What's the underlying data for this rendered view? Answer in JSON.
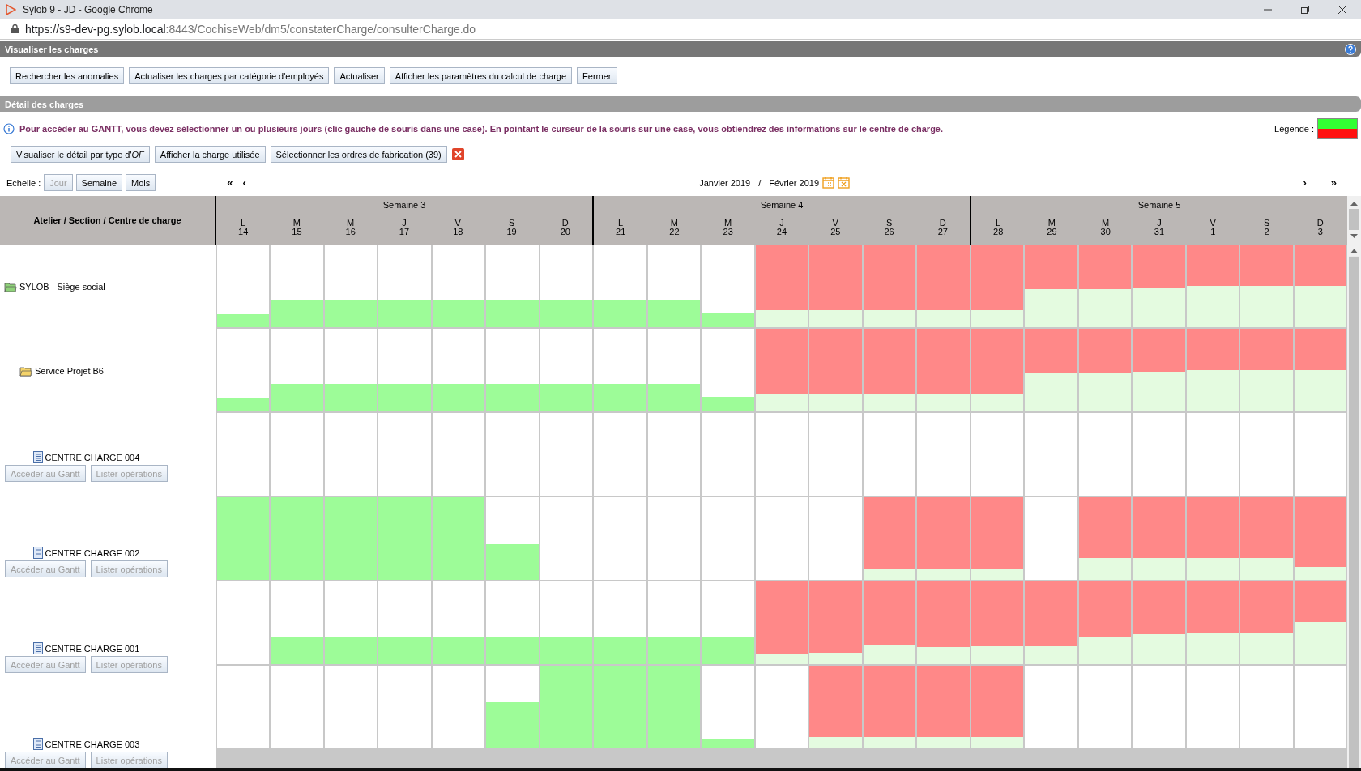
{
  "browser": {
    "title": "Sylob 9 - JD - Google Chrome",
    "url_host": "https://s9-dev-pg.sylob.local",
    "url_path": ":8443/CochiseWeb/dm5/constaterCharge/consulterCharge.do"
  },
  "page_title": "Visualiser les charges",
  "toolbar": [
    {
      "label": "Rechercher les anomalies"
    },
    {
      "label": "Actualiser les charges par catégorie d'employés"
    },
    {
      "label": "Actualiser"
    },
    {
      "label": "Afficher les paramètres du calcul de charge"
    },
    {
      "label": "Fermer"
    }
  ],
  "section_title": "Détail des charges",
  "info": "Pour accéder au GANTT, vous devez sélectionner un ou plusieurs jours (clic gauche de souris dans une case). En pointant le curseur de la souris sur une case, vous obtiendrez des informations sur le centre de charge.",
  "legend": {
    "label": "Légende :",
    "items": [
      {
        "color": "#33ff33"
      },
      {
        "color": "#ff1111"
      }
    ]
  },
  "actions": [
    {
      "label": "Visualiser le détail par type d'*OF*"
    },
    {
      "label": "Afficher la charge utilisée"
    },
    {
      "label": "Sélectionner les ordres de fabrication (39)"
    }
  ],
  "scale": {
    "label": "Echelle :",
    "options": [
      {
        "label": "Jour",
        "disabled": true
      },
      {
        "label": "Semaine",
        "disabled": false
      },
      {
        "label": "Mois",
        "disabled": false
      }
    ]
  },
  "nav": {
    "first": "«",
    "prev": "‹",
    "next": "›",
    "last": "»"
  },
  "period": {
    "from": "Janvier 2019",
    "separator": "/",
    "to": "Février 2019"
  },
  "grid": {
    "row_header": "Atelier / Section / Centre de charge",
    "weeks": [
      {
        "label": "Semaine 3",
        "days": [
          {
            "letter": "L",
            "day": "14"
          },
          {
            "letter": "M",
            "day": "15"
          },
          {
            "letter": "M",
            "day": "16"
          },
          {
            "letter": "J",
            "day": "17"
          },
          {
            "letter": "V",
            "day": "18"
          },
          {
            "letter": "S",
            "day": "19"
          },
          {
            "letter": "D",
            "day": "20"
          }
        ]
      },
      {
        "label": "Semaine 4",
        "days": [
          {
            "letter": "L",
            "day": "21"
          },
          {
            "letter": "M",
            "day": "22"
          },
          {
            "letter": "M",
            "day": "23"
          },
          {
            "letter": "J",
            "day": "24"
          },
          {
            "letter": "V",
            "day": "25"
          },
          {
            "letter": "S",
            "day": "26"
          },
          {
            "letter": "D",
            "day": "27"
          }
        ]
      },
      {
        "label": "Semaine 5",
        "days": [
          {
            "letter": "L",
            "day": "28"
          },
          {
            "letter": "M",
            "day": "29"
          },
          {
            "letter": "M",
            "day": "30"
          },
          {
            "letter": "J",
            "day": "31"
          },
          {
            "letter": "V",
            "day": "1"
          },
          {
            "letter": "S",
            "day": "2"
          },
          {
            "letter": "D",
            "day": "3"
          }
        ]
      }
    ],
    "rows": [
      {
        "kind": "site",
        "name": "SYLOB - Siège social",
        "cells": [
          {
            "kind": "under",
            "level": 0.16
          },
          {
            "kind": "under",
            "level": 0.33
          },
          {
            "kind": "under",
            "level": 0.33
          },
          {
            "kind": "under",
            "level": 0.33
          },
          {
            "kind": "under",
            "level": 0.33
          },
          {
            "kind": "under",
            "level": 0.33
          },
          {
            "kind": "under",
            "level": 0.33
          },
          {
            "kind": "under",
            "level": 0.33
          },
          {
            "kind": "under",
            "level": 0.33
          },
          {
            "kind": "under",
            "level": 0.18
          },
          {
            "kind": "over",
            "level": 0.21
          },
          {
            "kind": "over",
            "level": 0.21
          },
          {
            "kind": "over",
            "level": 0.21
          },
          {
            "kind": "over",
            "level": 0.21
          },
          {
            "kind": "over",
            "level": 0.21
          },
          {
            "kind": "over",
            "level": 0.46
          },
          {
            "kind": "over",
            "level": 0.46
          },
          {
            "kind": "over",
            "level": 0.48
          },
          {
            "kind": "over",
            "level": 0.5
          },
          {
            "kind": "over",
            "level": 0.5
          },
          {
            "kind": "over",
            "level": 0.5
          }
        ]
      },
      {
        "kind": "section",
        "name": "Service Projet B6",
        "cells": [
          {
            "kind": "under",
            "level": 0.17
          },
          {
            "kind": "under",
            "level": 0.33
          },
          {
            "kind": "under",
            "level": 0.33
          },
          {
            "kind": "under",
            "level": 0.33
          },
          {
            "kind": "under",
            "level": 0.33
          },
          {
            "kind": "under",
            "level": 0.33
          },
          {
            "kind": "under",
            "level": 0.33
          },
          {
            "kind": "under",
            "level": 0.33
          },
          {
            "kind": "under",
            "level": 0.33
          },
          {
            "kind": "under",
            "level": 0.18
          },
          {
            "kind": "over",
            "level": 0.21
          },
          {
            "kind": "over",
            "level": 0.21
          },
          {
            "kind": "over",
            "level": 0.21
          },
          {
            "kind": "over",
            "level": 0.21
          },
          {
            "kind": "over",
            "level": 0.21
          },
          {
            "kind": "over",
            "level": 0.46
          },
          {
            "kind": "over",
            "level": 0.46
          },
          {
            "kind": "over",
            "level": 0.48
          },
          {
            "kind": "over",
            "level": 0.5
          },
          {
            "kind": "over",
            "level": 0.5
          },
          {
            "kind": "over",
            "level": 0.5
          }
        ]
      },
      {
        "kind": "centre",
        "name": "CENTRE CHARGE 004",
        "buttons": [
          {
            "label": "Accéder au Gantt",
            "disabled": true
          },
          {
            "label": "Lister opérations",
            "disabled": true
          }
        ],
        "cells": [
          {
            "kind": "empty"
          },
          {
            "kind": "empty"
          },
          {
            "kind": "empty"
          },
          {
            "kind": "empty"
          },
          {
            "kind": "empty"
          },
          {
            "kind": "empty"
          },
          {
            "kind": "empty"
          },
          {
            "kind": "empty"
          },
          {
            "kind": "empty"
          },
          {
            "kind": "empty"
          },
          {
            "kind": "empty"
          },
          {
            "kind": "empty"
          },
          {
            "kind": "empty"
          },
          {
            "kind": "empty"
          },
          {
            "kind": "empty"
          },
          {
            "kind": "empty"
          },
          {
            "kind": "empty"
          },
          {
            "kind": "empty"
          },
          {
            "kind": "empty"
          },
          {
            "kind": "empty"
          },
          {
            "kind": "empty"
          }
        ]
      },
      {
        "kind": "centre",
        "name": "CENTRE CHARGE 002",
        "buttons": [
          {
            "label": "Accéder au Gantt",
            "disabled": true
          },
          {
            "label": "Lister opérations",
            "disabled": true
          }
        ],
        "cells": [
          {
            "kind": "under",
            "level": 1
          },
          {
            "kind": "under",
            "level": 1
          },
          {
            "kind": "under",
            "level": 1
          },
          {
            "kind": "under",
            "level": 1
          },
          {
            "kind": "under",
            "level": 1
          },
          {
            "kind": "under",
            "level": 0.43
          },
          {
            "kind": "empty"
          },
          {
            "kind": "empty"
          },
          {
            "kind": "empty"
          },
          {
            "kind": "empty"
          },
          {
            "kind": "empty"
          },
          {
            "kind": "empty"
          },
          {
            "kind": "over",
            "level": 0.14
          },
          {
            "kind": "over",
            "level": 0.14
          },
          {
            "kind": "over",
            "level": 0.14
          },
          {
            "kind": "empty"
          },
          {
            "kind": "over",
            "level": 0.26
          },
          {
            "kind": "over",
            "level": 0.26
          },
          {
            "kind": "over",
            "level": 0.26
          },
          {
            "kind": "over",
            "level": 0.26
          },
          {
            "kind": "over",
            "level": 0.16
          }
        ]
      },
      {
        "kind": "centre",
        "name": "CENTRE CHARGE 001",
        "buttons": [
          {
            "label": "Accéder au Gantt",
            "disabled": true
          },
          {
            "label": "Lister opérations",
            "disabled": true
          }
        ],
        "cells": [
          {
            "kind": "empty"
          },
          {
            "kind": "under",
            "level": 0.33
          },
          {
            "kind": "under",
            "level": 0.33
          },
          {
            "kind": "under",
            "level": 0.33
          },
          {
            "kind": "under",
            "level": 0.33
          },
          {
            "kind": "under",
            "level": 0.33
          },
          {
            "kind": "under",
            "level": 0.33
          },
          {
            "kind": "under",
            "level": 0.33
          },
          {
            "kind": "under",
            "level": 0.33
          },
          {
            "kind": "under",
            "level": 0.33
          },
          {
            "kind": "over",
            "level": 0.12
          },
          {
            "kind": "over",
            "level": 0.14
          },
          {
            "kind": "over",
            "level": 0.23
          },
          {
            "kind": "over",
            "level": 0.21
          },
          {
            "kind": "over",
            "level": 0.22
          },
          {
            "kind": "over",
            "level": 0.22
          },
          {
            "kind": "over",
            "level": 0.33
          },
          {
            "kind": "over",
            "level": 0.36
          },
          {
            "kind": "over",
            "level": 0.38
          },
          {
            "kind": "over",
            "level": 0.38
          },
          {
            "kind": "over",
            "level": 0.51
          }
        ]
      },
      {
        "kind": "centre",
        "name": "CENTRE CHARGE 003",
        "buttons": [
          {
            "label": "Accéder au Gantt",
            "disabled": true
          },
          {
            "label": "Lister opérations",
            "disabled": true
          }
        ],
        "cells": [
          {
            "kind": "empty"
          },
          {
            "kind": "empty"
          },
          {
            "kind": "empty"
          },
          {
            "kind": "empty"
          },
          {
            "kind": "empty"
          },
          {
            "kind": "under",
            "level": 0.56
          },
          {
            "kind": "under",
            "level": 1
          },
          {
            "kind": "under",
            "level": 1
          },
          {
            "kind": "under",
            "level": 1
          },
          {
            "kind": "under",
            "level": 0.12
          },
          {
            "kind": "empty"
          },
          {
            "kind": "over",
            "level": 0.14
          },
          {
            "kind": "over",
            "level": 0.14
          },
          {
            "kind": "over",
            "level": 0.14
          },
          {
            "kind": "over",
            "level": 0.14
          },
          {
            "kind": "empty"
          },
          {
            "kind": "empty"
          },
          {
            "kind": "empty"
          },
          {
            "kind": "empty"
          },
          {
            "kind": "empty"
          },
          {
            "kind": "empty"
          }
        ]
      }
    ]
  }
}
